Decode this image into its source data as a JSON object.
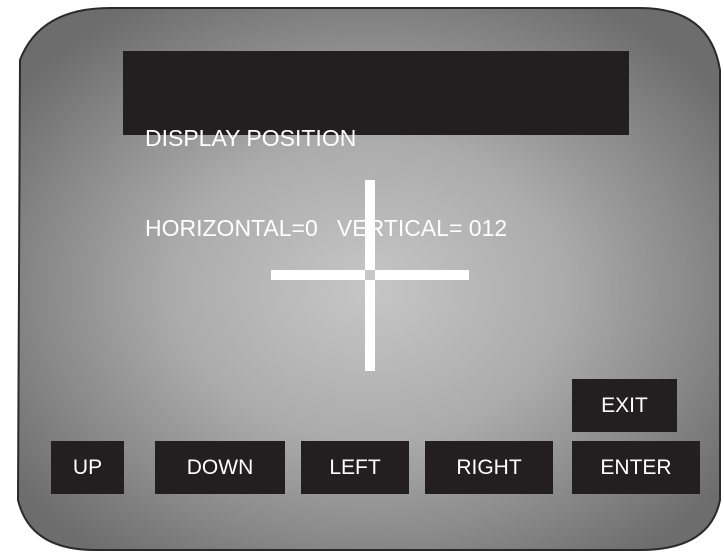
{
  "osd": {
    "title": "DISPLAY POSITION",
    "status": "HORIZONTAL=0   VERTICAL= 012"
  },
  "buttons": {
    "up": "UP",
    "down": "DOWN",
    "left": "LEFT",
    "right": "RIGHT",
    "enter": "ENTER",
    "exit": "EXIT"
  },
  "colors": {
    "panel": "#231f20",
    "text": "#ffffff",
    "screen_outer": "#7a7a7a",
    "screen_center": "#c4c4c4"
  }
}
